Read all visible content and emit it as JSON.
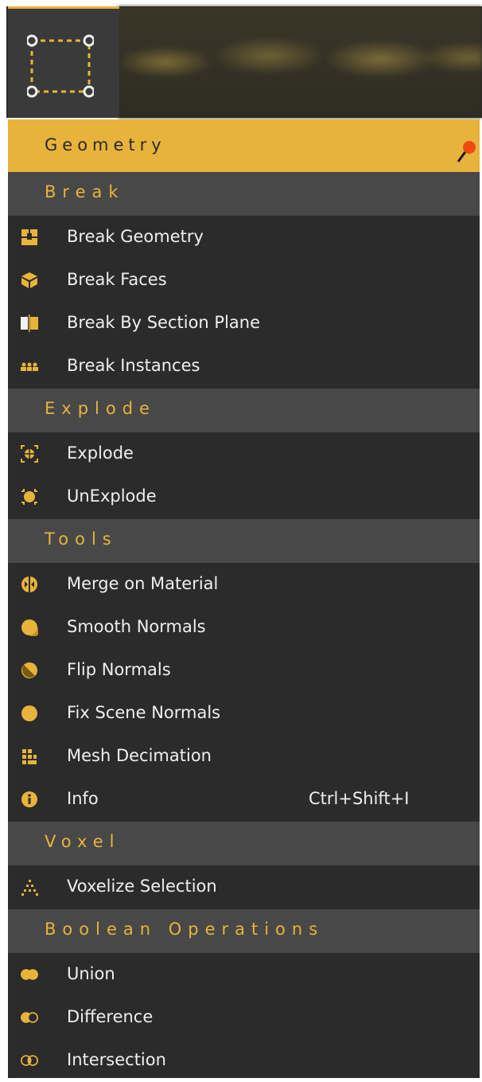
{
  "toolbar": {
    "icon": "bounding-box-icon"
  },
  "menu": {
    "title": "Geometry",
    "pin_icon": "pin-icon",
    "accent": "#e8b33a",
    "sections": {
      "break": "Break",
      "explode": "Explode",
      "tools": "Tools",
      "voxel": "Voxel",
      "boolean": "Boolean Operations"
    },
    "items": {
      "break_geometry": "Break Geometry",
      "break_faces": "Break Faces",
      "break_by_section_plane": "Break By Section Plane",
      "break_instances": "Break Instances",
      "explode": "Explode",
      "unexplode": "UnExplode",
      "merge_on_material": "Merge on Material",
      "smooth_normals": "Smooth Normals",
      "flip_normals": "Flip Normals",
      "fix_scene_normals": "Fix Scene Normals",
      "mesh_decimation": "Mesh Decimation",
      "info": "Info",
      "info_shortcut": "Ctrl+Shift+I",
      "voxelize_selection": "Voxelize Selection",
      "union": "Union",
      "difference": "Difference",
      "intersection": "Intersection"
    }
  }
}
